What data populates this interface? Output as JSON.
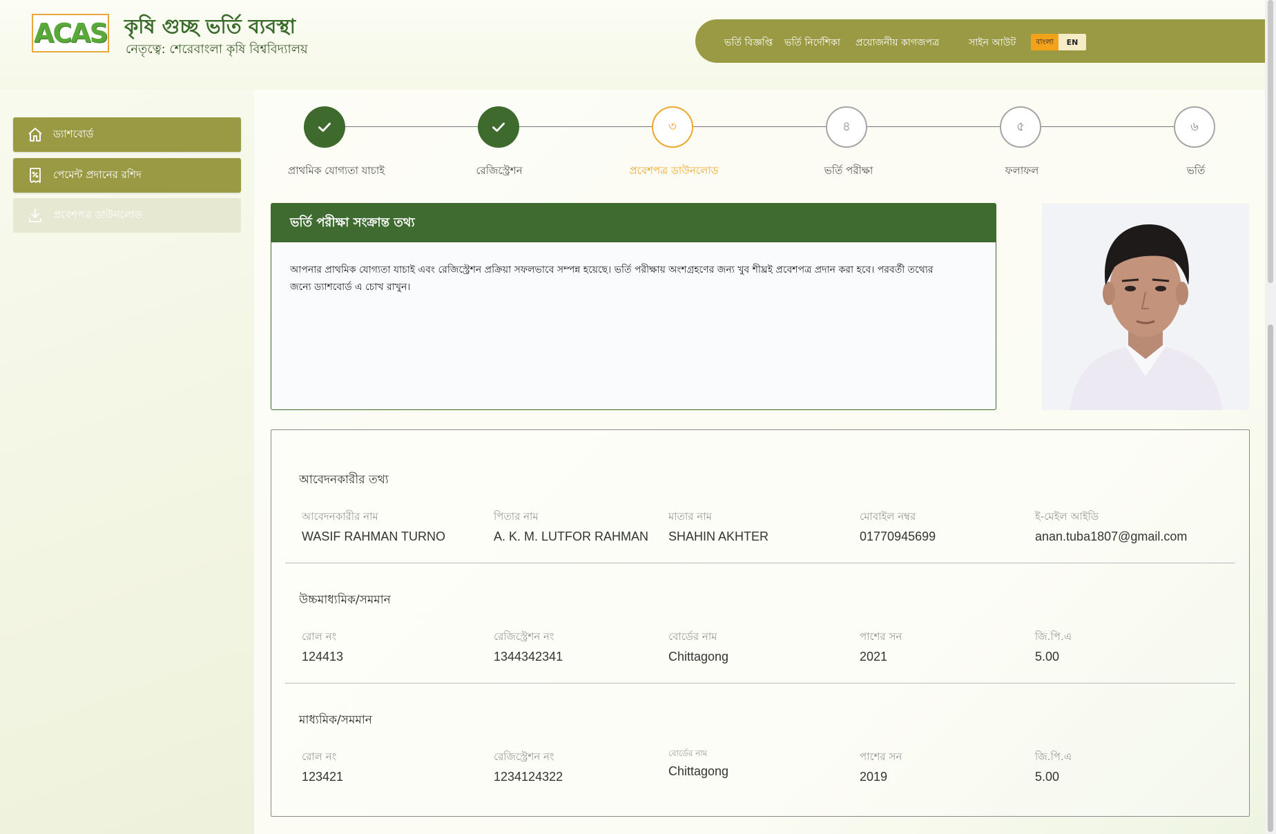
{
  "header": {
    "logo_text": "ACAS",
    "title": "কৃষি গুচ্ছ ভর্তি ব্যবস্থা",
    "subtitle": "নেতৃত্বে: শেরেবাংলা কৃষি বিশ্ববিদ্যালয়",
    "nav": {
      "admission_notice": "ভর্তি বিজ্ঞপ্তি",
      "admission_guide": "ভর্তি নির্দেশিকা",
      "required_documents": "প্রয়োজনীয় কাগজপত্র",
      "sign_out": "সাইন আউট"
    },
    "lang": {
      "bn": "বাংলা",
      "en": "EN",
      "active": "bn"
    }
  },
  "sidebar": {
    "items": [
      {
        "label": "ড্যাশবোর্ড",
        "icon": "home-icon",
        "state": "active"
      },
      {
        "label": "পেমেন্ট প্রদানের রশিদ",
        "icon": "receipt-icon",
        "state": "active"
      },
      {
        "label": "প্রবেশপত্র ডাউনলোড",
        "icon": "download-icon",
        "state": "disabled"
      }
    ]
  },
  "stepper": {
    "steps": [
      {
        "label": "প্রাথমিক যোগ্যতা যাচাই",
        "number": "",
        "status": "done"
      },
      {
        "label": "রেজিস্ট্রেশন",
        "number": "",
        "status": "done"
      },
      {
        "label": "প্রবেশপত্র ডাউনলোড",
        "number": "৩",
        "status": "current"
      },
      {
        "label": "ভর্তি পরীক্ষা",
        "number": "৪",
        "status": "pending"
      },
      {
        "label": "ফলাফল",
        "number": "৫",
        "status": "pending"
      },
      {
        "label": "ভর্তি",
        "number": "৬",
        "status": "pending"
      }
    ]
  },
  "info": {
    "title": "ভর্তি পরীক্ষা সংক্রান্ত তথ্য",
    "body": "আপনার প্রাথমিক যোগ্যতা যাচাই এবং রেজিস্ট্রেশন প্রক্রিয়া সফলভাবে সম্পন্ন হয়েছে। ভর্তি পরীক্ষায় অংশগ্রহণের জন্য খুব শীঘ্রই প্রবেশপত্র প্রদান করা হবে। পরবর্তী তথ্যের জন্যে ড্যাশবোর্ড এ চোখ রাখুন।"
  },
  "applicant": {
    "title": "আবেদনকারীর তথ্য",
    "fields": [
      {
        "label": "আবেদনকারীর নাম",
        "value": "WASIF RAHMAN TURNO"
      },
      {
        "label": "পিতার নাম",
        "value": "A. K. M. LUTFOR RAHMAN"
      },
      {
        "label": "মাতার নাম",
        "value": "SHAHIN AKHTER"
      },
      {
        "label": "মোবাইল নম্বর",
        "value": "01770945699"
      },
      {
        "label": "ই-মেইল আইডি",
        "value": "anan.tuba1807@gmail.com"
      }
    ]
  },
  "hsc": {
    "title": "উচ্চমাধ্যমিক/সমমান",
    "fields": [
      {
        "label": "রোল নং",
        "value": "124413"
      },
      {
        "label": "রেজিস্ট্রেশন নং",
        "value": "1344342341"
      },
      {
        "label": "বোর্ডের নাম",
        "value": "Chittagong"
      },
      {
        "label": "পাশের সন",
        "value": "2021"
      },
      {
        "label": "জি.পি.এ",
        "value": "5.00"
      }
    ]
  },
  "ssc": {
    "title": "মাধ্যমিক/সমমান",
    "fields": [
      {
        "label": "রোল নং",
        "value": "123421"
      },
      {
        "label": "রেজিস্ট্রেশন নং",
        "value": "1234124322"
      },
      {
        "label": "বোর্ডের নাম",
        "value": "Chittagong"
      },
      {
        "label": "পাশের সন",
        "value": "2019"
      },
      {
        "label": "জি.পি.এ",
        "value": "5.00"
      }
    ]
  },
  "colors": {
    "olive": "#9a9a45",
    "dark_green": "#3f6b30",
    "accent_orange": "#f0a62a"
  }
}
